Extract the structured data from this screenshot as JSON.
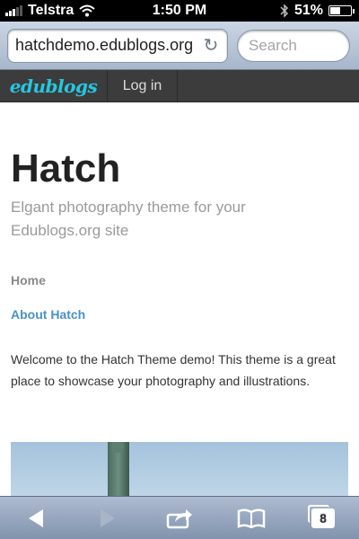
{
  "status_bar": {
    "carrier": "Telstra",
    "time": "1:50 PM",
    "battery_percent": "51%",
    "battery_level": 0.51,
    "icons": [
      "signal-icon",
      "wifi-icon",
      "bluetooth-icon",
      "battery-icon"
    ]
  },
  "browser": {
    "url": "hatchdemo.edublogs.org",
    "search_placeholder": "Search",
    "reload_icon": "reload-icon",
    "toolbar": {
      "back_icon": "back-icon",
      "forward_icon": "forward-icon",
      "share_icon": "share-icon",
      "bookmarks_icon": "bookmarks-icon",
      "tabs_icon": "tabs-icon",
      "tabs_count": "8"
    }
  },
  "site_nav": {
    "brand": "edublogs",
    "login_label": "Log in"
  },
  "page": {
    "title": "Hatch",
    "tagline": "Elgant photography theme for your Edublogs.org site",
    "menu": [
      {
        "label": "Home"
      },
      {
        "label": "About Hatch"
      }
    ],
    "intro": "Welcome to the Hatch Theme demo! This theme is a great place to showcase your photography and illustrations."
  },
  "colors": {
    "brand": "#27c6e0",
    "link": "#4a90c8",
    "nav_bg": "#3c3c3c"
  }
}
